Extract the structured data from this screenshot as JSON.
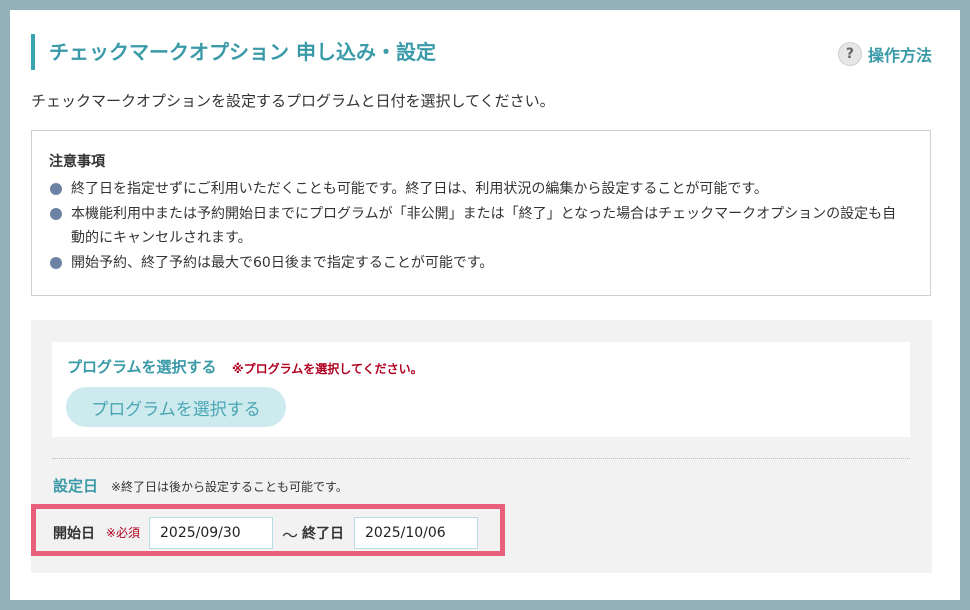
{
  "header": {
    "title": "チェックマークオプション 申し込み・設定",
    "help_label": "操作方法",
    "help_icon": "?"
  },
  "description": "チェックマークオプションを設定するプログラムと日付を選択してください。",
  "notice": {
    "title": "注意事項",
    "items": [
      "終了日を指定せずにご利用いただくことも可能です。終了日は、利用状況の編集から設定することが可能です。",
      "本機能利用中または予約開始日までにプログラムが「非公開」または「終了」となった場合はチェックマークオプションの設定も自動的にキャンセルされます。",
      "開始予約、終了予約は最大で60日後まで指定することが可能です。"
    ]
  },
  "program": {
    "title": "プログラムを選択する",
    "error": "※プログラムを選択してください。",
    "button_label": "プログラムを選択する"
  },
  "dates": {
    "title": "設定日",
    "note": "※終了日は後から設定することも可能です。",
    "start_label": "開始日",
    "required_label": "※必須",
    "start_value": "2025/09/30",
    "separator": "〜",
    "end_label": "終了日",
    "end_value": "2025/10/06"
  },
  "colors": {
    "accent": "#3a9aa8",
    "highlight_border": "#e85f7c",
    "error": "#b00020",
    "frame": "#94b0b9"
  }
}
